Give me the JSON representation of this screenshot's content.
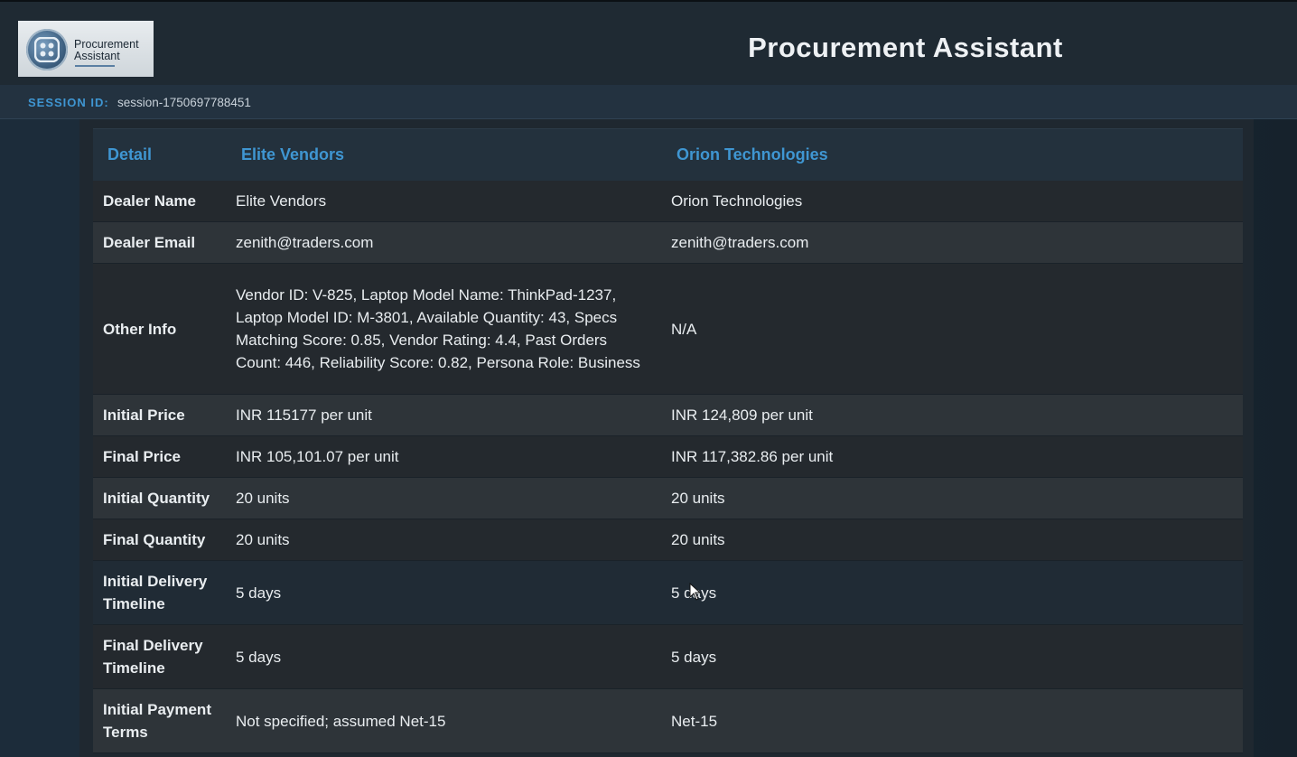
{
  "logo": {
    "line1": "Procurement",
    "line2": "Assistant"
  },
  "app_title": "Procurement Assistant",
  "session": {
    "label": "SESSION ID:",
    "value": "session-1750697788451"
  },
  "table": {
    "headers": [
      "Detail",
      "Elite Vendors",
      "Orion Technologies"
    ],
    "rows": [
      {
        "key": "Dealer Name",
        "a": "Elite Vendors",
        "b": "Orion Technologies"
      },
      {
        "key": "Dealer Email",
        "a": "zenith@traders.com",
        "b": "zenith@traders.com"
      },
      {
        "key": "Other Info",
        "a": "Vendor ID: V-825, Laptop Model Name: ThinkPad-1237, Laptop Model ID: M-3801, Available Quantity: 43, Specs Matching Score: 0.85, Vendor Rating: 4.4, Past Orders Count: 446, Reliability Score: 0.82, Persona Role: Business",
        "b": "N/A"
      },
      {
        "key": "Initial Price",
        "a": "INR 115177 per unit",
        "b": "INR 124,809 per unit"
      },
      {
        "key": "Final Price",
        "a": "INR 105,101.07 per unit",
        "b": "INR 117,382.86 per unit"
      },
      {
        "key": "Initial Quantity",
        "a": "20 units",
        "b": "20 units"
      },
      {
        "key": "Final Quantity",
        "a": "20 units",
        "b": "20 units"
      },
      {
        "key": "Initial Delivery Timeline",
        "a": "5 days",
        "b": "5 days"
      },
      {
        "key": "Final Delivery Timeline",
        "a": "5 days",
        "b": "5 days"
      },
      {
        "key": "Initial Payment Terms",
        "a": "Not specified; assumed Net-15",
        "b": "Net-15"
      }
    ]
  }
}
